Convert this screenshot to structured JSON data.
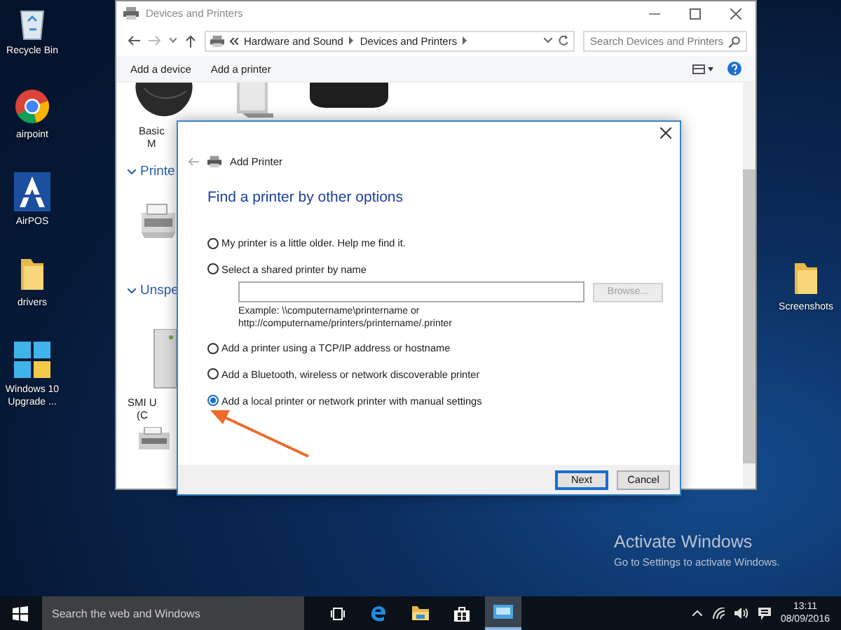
{
  "desktop_icons": [
    {
      "kind": "bin",
      "label": "Recycle Bin"
    },
    {
      "kind": "globe",
      "label": "airpoint"
    },
    {
      "kind": "app",
      "label": "AirPOS"
    },
    {
      "kind": "folder",
      "label": "drivers"
    },
    {
      "kind": "tiles",
      "label": "Windows 10 Upgrade ..."
    }
  ],
  "desktop_icons_right": [
    {
      "kind": "folder",
      "label": "Screenshots"
    }
  ],
  "explorer": {
    "title": "Devices and Printers",
    "breadcrumb": [
      "Hardware and Sound",
      "Devices and Printers"
    ],
    "search": {
      "placeholder": "Search Devices and Printers"
    },
    "commands": [
      "Add a device",
      "Add a printer"
    ],
    "first_device_label": [
      "Basic",
      "M"
    ],
    "sections": [
      "Printe",
      "Unspe"
    ],
    "unspecified_device_label": [
      "SMI U",
      "(C"
    ]
  },
  "dialog": {
    "title": "Add Printer",
    "heading": "Find a printer by other options",
    "options": [
      {
        "kind": "plain",
        "label": "My printer is a little older. Help me find it.",
        "selected": false
      },
      {
        "kind": "shared",
        "label": "Select a shared printer by name",
        "selected": false,
        "browse": {
          "label": "Browse...",
          "disabled": true
        },
        "example": [
          "Example: \\\\computername\\printername or",
          "http://computername/printers/printername/.printer"
        ]
      },
      {
        "kind": "plain",
        "label": "Add a printer using a TCP/IP address or hostname",
        "selected": false
      },
      {
        "kind": "plain",
        "label": "Add a Bluetooth, wireless or network discoverable printer",
        "selected": false
      },
      {
        "kind": "plain",
        "label": "Add a local printer or network printer with manual settings",
        "selected": true
      }
    ],
    "buttons": [
      {
        "label": "Next",
        "default": true
      },
      {
        "label": "Cancel",
        "default": false
      }
    ]
  },
  "activation": {
    "title": "Activate Windows",
    "text": "Go to Settings to activate Windows."
  },
  "taskbar": {
    "search": {
      "placeholder": "Search the web and Windows"
    },
    "time": "13:11",
    "date": "08/09/2016"
  }
}
